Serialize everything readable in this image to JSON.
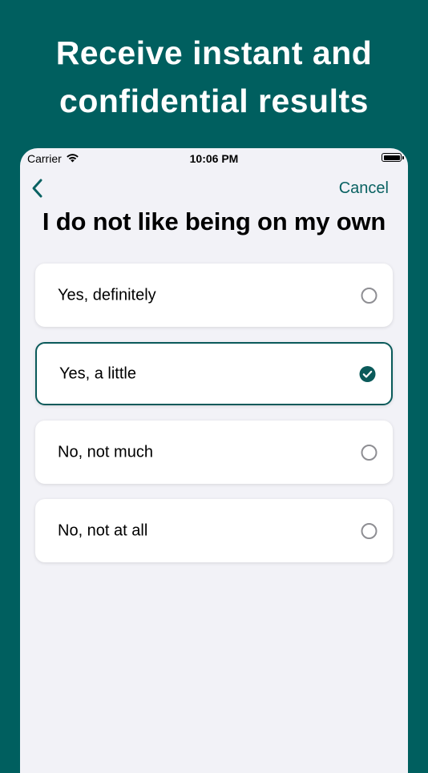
{
  "headline": {
    "line1": "Receive instant and",
    "line2": "confidential results"
  },
  "status_bar": {
    "carrier": "Carrier",
    "time": "10:06 PM"
  },
  "nav": {
    "cancel_label": "Cancel"
  },
  "question": {
    "title": "I do not like being on my own"
  },
  "options": [
    {
      "label": "Yes, definitely",
      "selected": false
    },
    {
      "label": "Yes, a little",
      "selected": true
    },
    {
      "label": "No, not much",
      "selected": false
    },
    {
      "label": "No, not at all",
      "selected": false
    }
  ],
  "colors": {
    "brand": "#005f5f",
    "accent": "#0a6262",
    "background": "#f2f2f7"
  },
  "icons": {
    "back": "chevron-left-icon",
    "wifi": "wifi-icon",
    "battery": "battery-icon",
    "radio_unselected": "radio-empty-icon",
    "radio_selected": "checkmark-circle-icon"
  }
}
